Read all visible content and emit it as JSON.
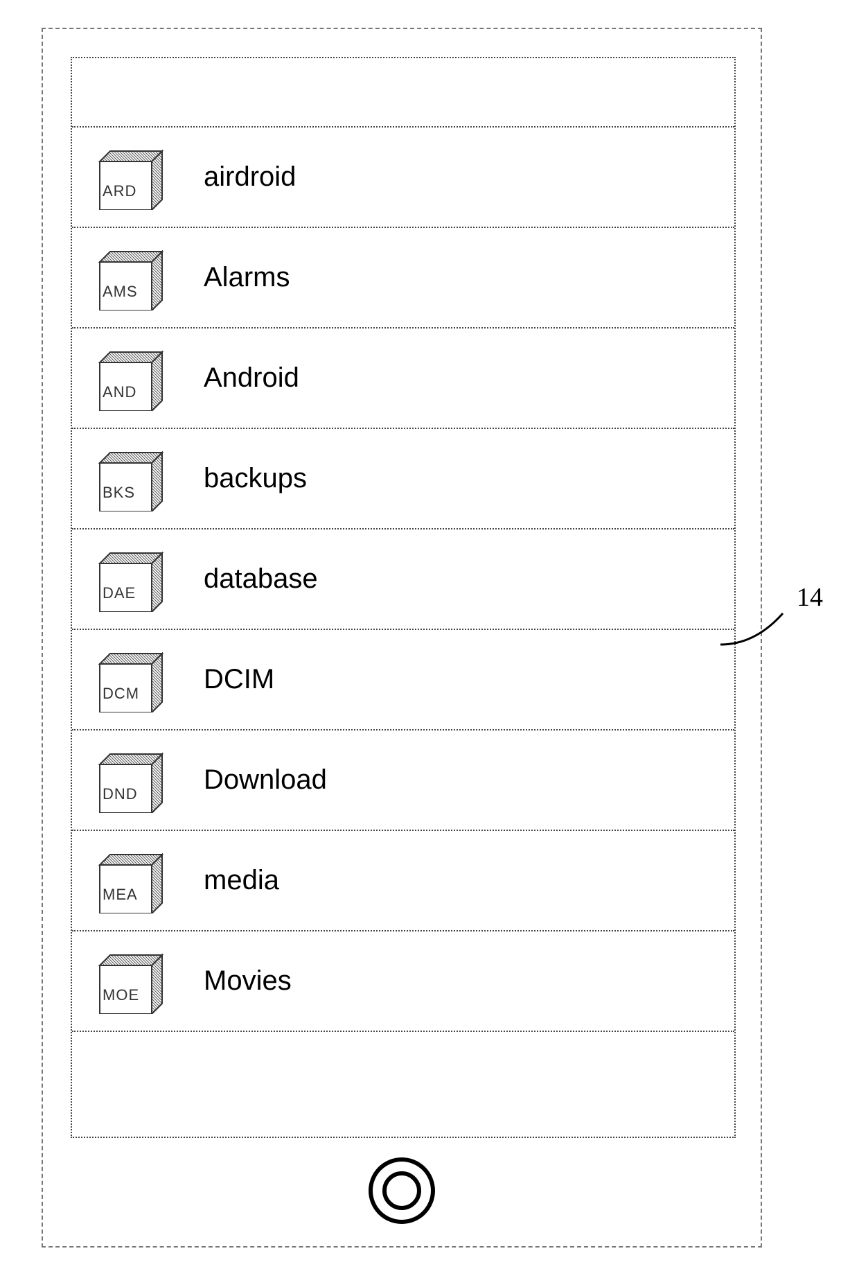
{
  "callout": "14",
  "folders": [
    {
      "code": "ARD",
      "label": "airdroid"
    },
    {
      "code": "AMS",
      "label": "Alarms"
    },
    {
      "code": "AND",
      "label": "Android"
    },
    {
      "code": "BKS",
      "label": "backups"
    },
    {
      "code": "DAE",
      "label": "database"
    },
    {
      "code": "DCM",
      "label": "DCIM"
    },
    {
      "code": "DND",
      "label": "Download"
    },
    {
      "code": "MEA",
      "label": "media"
    },
    {
      "code": "MOE",
      "label": "Movies"
    }
  ]
}
